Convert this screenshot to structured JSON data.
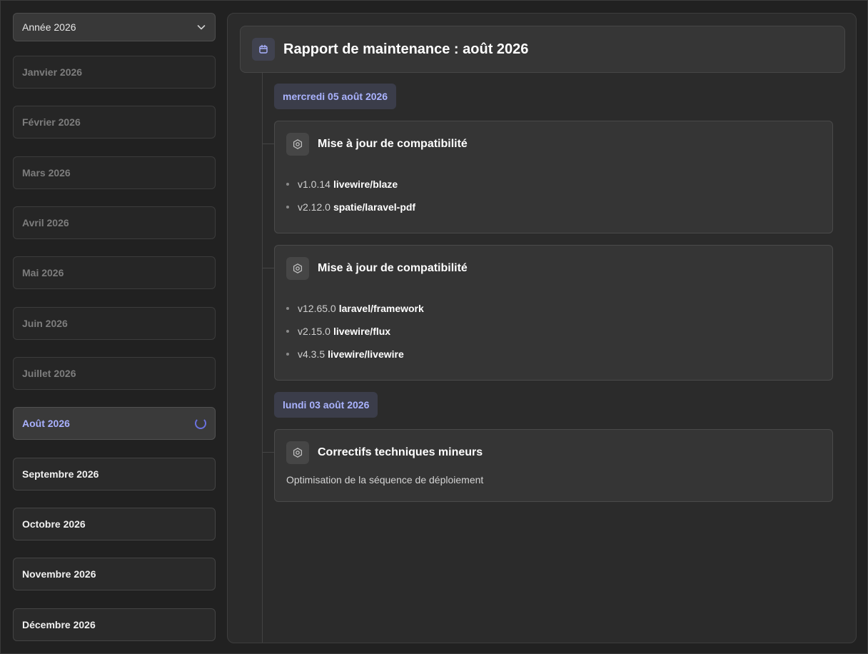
{
  "sidebar": {
    "year_select": {
      "value": "Année 2026",
      "icon": "chevron-down-icon"
    },
    "months": [
      {
        "label": "Janvier 2026",
        "state": "past"
      },
      {
        "label": "Février 2026",
        "state": "past"
      },
      {
        "label": "Mars 2026",
        "state": "past"
      },
      {
        "label": "Avril 2026",
        "state": "past"
      },
      {
        "label": "Mai 2026",
        "state": "past"
      },
      {
        "label": "Juin 2026",
        "state": "past"
      },
      {
        "label": "Juillet 2026",
        "state": "past"
      },
      {
        "label": "Août 2026",
        "state": "active",
        "loading": true
      },
      {
        "label": "Septembre 2026",
        "state": "future"
      },
      {
        "label": "Octobre 2026",
        "state": "future"
      },
      {
        "label": "Novembre 2026",
        "state": "future"
      },
      {
        "label": "Décembre 2026",
        "state": "future"
      }
    ]
  },
  "report": {
    "title": "Rapport de maintenance : août 2026",
    "icon": "calendar-icon",
    "days": [
      {
        "date": "mercredi 05 août 2026",
        "entries": [
          {
            "title": "Mise à jour de compatibilité",
            "icon": "gear-icon",
            "packages": [
              {
                "version": "v1.0.14",
                "name": "livewire/blaze"
              },
              {
                "version": "v2.12.0",
                "name": "spatie/laravel-pdf"
              }
            ]
          },
          {
            "title": "Mise à jour de compatibilité",
            "icon": "gear-icon",
            "packages": [
              {
                "version": "v12.65.0",
                "name": "laravel/framework"
              },
              {
                "version": "v2.15.0",
                "name": "livewire/flux"
              },
              {
                "version": "v4.3.5",
                "name": "livewire/livewire"
              }
            ]
          }
        ]
      },
      {
        "date": "lundi 03 août 2026",
        "entries": [
          {
            "title": "Correctifs techniques mineurs",
            "icon": "gear-icon",
            "description": "Optimisation de la séquence de déploiement"
          }
        ]
      }
    ]
  },
  "colors": {
    "accent": "#a9b1ff",
    "background": "#212121",
    "panel": "#2b2b2b"
  }
}
